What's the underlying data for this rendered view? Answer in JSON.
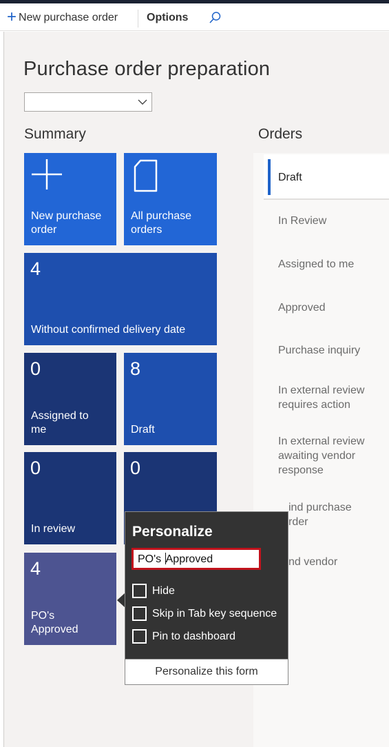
{
  "actionbar": {
    "new_label": "New purchase order",
    "options_label": "Options",
    "search_icon": "search-icon"
  },
  "page": {
    "title": "Purchase order preparation",
    "dropdown_value": ""
  },
  "summary": {
    "title": "Summary",
    "tiles": [
      {
        "label": "New purchase order",
        "icon": "plus-icon",
        "color": "#2266d6"
      },
      {
        "label": "All purchase orders",
        "icon": "document-icon",
        "color": "#2266d6"
      },
      {
        "count": "4",
        "label": "Without confirmed delivery date",
        "color": "#1e4fae"
      },
      {
        "count": "0",
        "label": "Assigned to me",
        "color": "#1b3575"
      },
      {
        "count": "8",
        "label": "Draft",
        "color": "#1e4fae"
      },
      {
        "count": "0",
        "label": "In review",
        "color": "#1b3575"
      },
      {
        "count": "0",
        "label": "",
        "color": "#1b3575"
      },
      {
        "count": "4",
        "label": "PO's Approved",
        "color": "#4d5491"
      }
    ]
  },
  "orders": {
    "title": "Orders",
    "items": [
      "Draft",
      "In Review",
      "Assigned to me",
      "Approved",
      "Purchase inquiry",
      "In external review requires action",
      "In external review awaiting vendor response",
      "Find purchase order",
      "Find vendor"
    ],
    "visible_items": [
      "Draft",
      "In Review",
      "Assigned to me",
      "Approved",
      "Purchase inquiry",
      "In external review requires action",
      "In external review awaiting vendor response",
      "ind purchase rder",
      "nd vendor"
    ],
    "selected": "Draft",
    "accent_color": "#1f63c9"
  },
  "personalize": {
    "title": "Personalize",
    "input_before_caret": "PO's ",
    "input_after_caret": "Approved",
    "options": [
      "Hide",
      "Skip in Tab key sequence",
      "Pin to dashboard"
    ],
    "footer_button": "Personalize this form",
    "input_border_color": "#c1121c"
  }
}
